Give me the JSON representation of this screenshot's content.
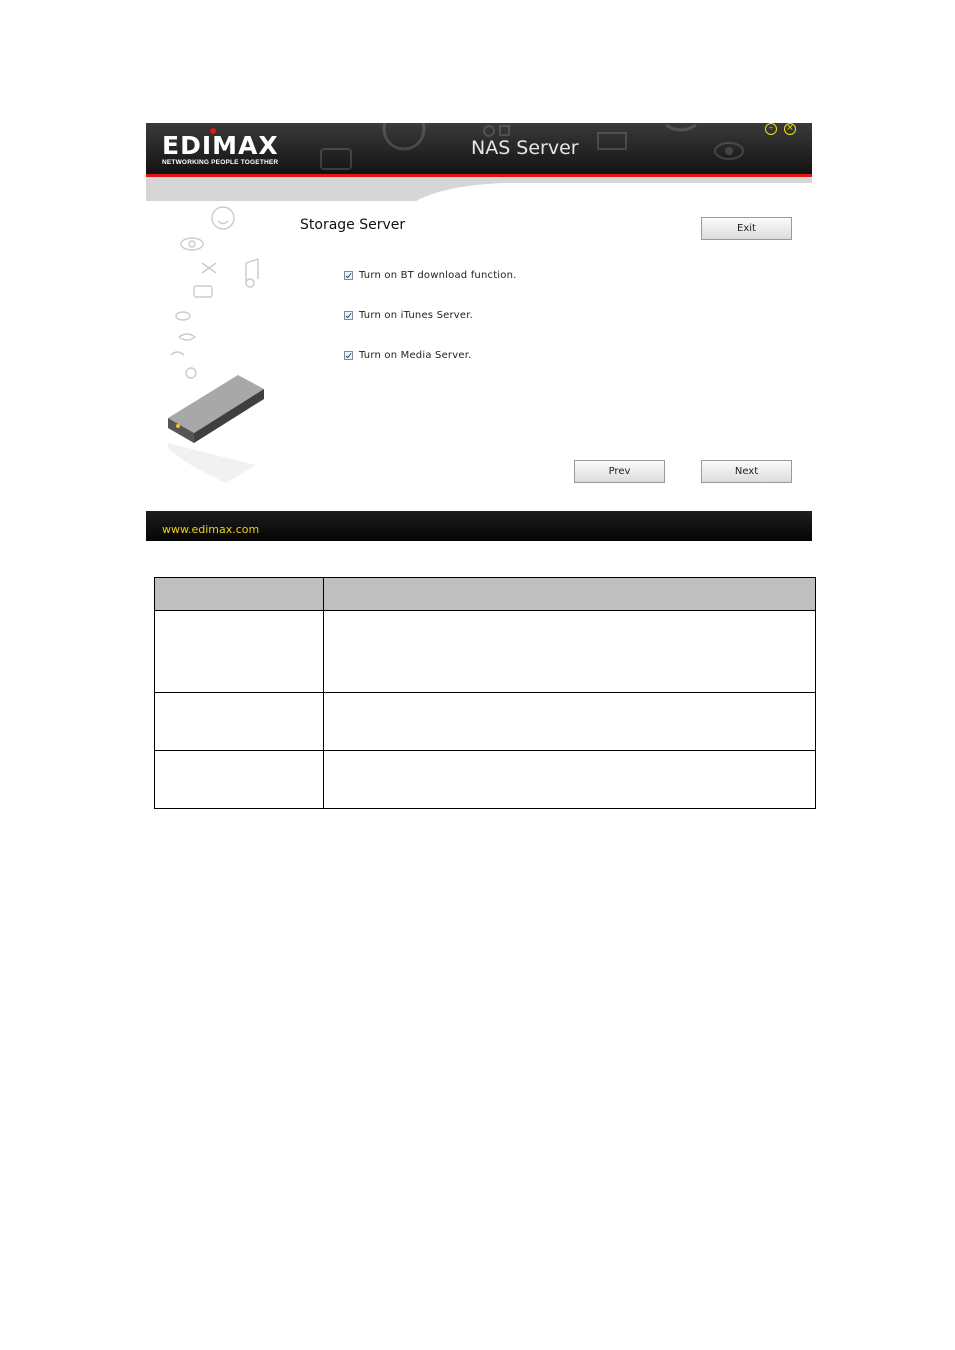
{
  "window": {
    "brand_name": "EDIMAX",
    "brand_tagline": "NETWORKING PEOPLE TOGETHER",
    "product_title": "NAS Server",
    "minimize_glyph": "–",
    "close_glyph": "×"
  },
  "page": {
    "title": "Storage Server",
    "exit_label": "Exit",
    "prev_label": "Prev",
    "next_label": "Next"
  },
  "options": [
    {
      "label": "Turn on BT download function.",
      "checked": true
    },
    {
      "label": "Turn on iTunes Server.",
      "checked": true
    },
    {
      "label": "Turn on Media Server.",
      "checked": true
    }
  ],
  "footer": {
    "url": "www.edimax.com"
  },
  "colors": {
    "accent_red": "#e3161b",
    "footer_url": "#e8d21c",
    "window_controls": "#f2e600"
  },
  "table": {
    "headers": [
      "",
      ""
    ],
    "rows": [
      [
        "",
        ""
      ],
      [
        "",
        ""
      ],
      [
        "",
        ""
      ]
    ]
  }
}
